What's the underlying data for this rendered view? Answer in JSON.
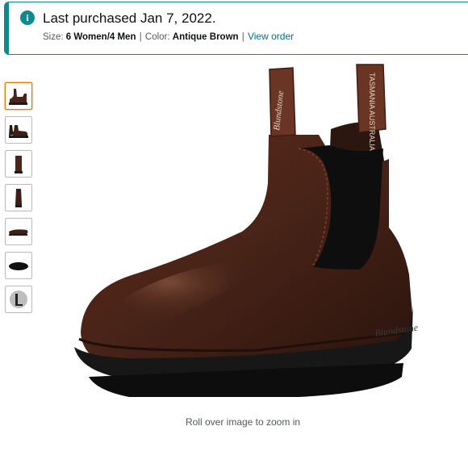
{
  "purchase": {
    "title": "Last purchased Jan 7, 2022.",
    "size_label": "Size:",
    "size_value": "6 Women/4 Men",
    "separator": "|",
    "color_label": "Color:",
    "color_value": "Antique Brown",
    "view_order_label": "View order",
    "info_icon": "info-icon",
    "accent_color": "#0f8a8c"
  },
  "gallery": {
    "thumbnails": [
      {
        "name": "boot-side-view-thumb",
        "active": true
      },
      {
        "name": "boot-pair-thumb",
        "active": false
      },
      {
        "name": "boot-front-thumb",
        "active": false
      },
      {
        "name": "boot-back-thumb",
        "active": false
      },
      {
        "name": "boot-sole-side-thumb",
        "active": false
      },
      {
        "name": "boot-sole-bottom-thumb",
        "active": false
      },
      {
        "name": "brand-logo-thumb",
        "active": false
      }
    ],
    "pull_tab_text_front": "Blundstone",
    "pull_tab_text_back": "TASMANIA AUSTRALIA",
    "sole_brand_text": "Blundstone",
    "zoom_hint": "Roll over image to zoom in",
    "boot_color": "#4a2418",
    "sole_color": "#1a1a1a"
  }
}
